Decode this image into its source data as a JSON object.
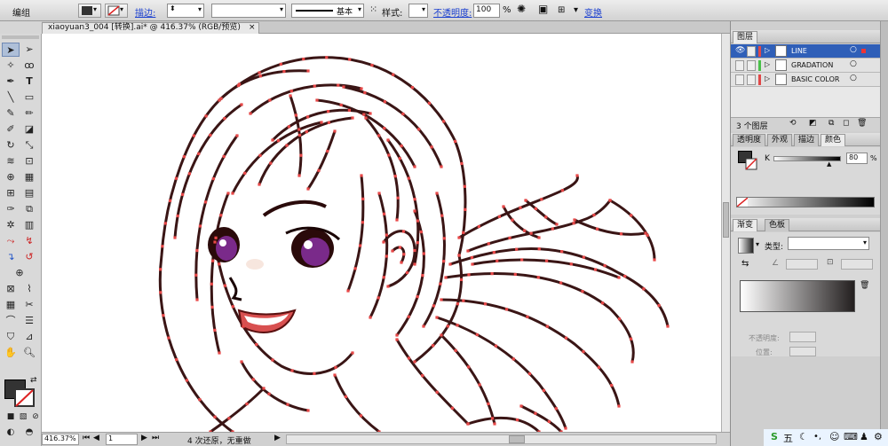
{
  "control_bar": {
    "object_type": "编组",
    "stroke_label": "描边:",
    "style_label": "样式:",
    "opacity_label": "不透明度:",
    "opacity_value": "100",
    "percent": "%",
    "brush_name": "基本",
    "transform_label": "变换"
  },
  "document_tab": {
    "title": "xiaoyuan3_004  [转换].ai* @ 416.37% (RGB/预览)",
    "close": "×"
  },
  "status_bar": {
    "zoom": "416.37%",
    "page": "1",
    "undo_info": "4 次还原，无重做"
  },
  "layers_panel": {
    "title": "图层",
    "layers": [
      {
        "name": "LINE",
        "color": "#e04848",
        "selected": true
      },
      {
        "name": "GRADATION",
        "color": "#48c048",
        "selected": false
      },
      {
        "name": "BASIC COLOR",
        "color": "#e04848",
        "selected": false
      }
    ],
    "count_label": "3 个图层"
  },
  "color_panel": {
    "tabs": [
      "透明度",
      "外观",
      "描边",
      "颜色"
    ],
    "active_tab": "颜色",
    "channel": "K",
    "value": "80",
    "percent": "%"
  },
  "gradient_panel": {
    "tabs": [
      "渐变",
      "色板"
    ],
    "active_tab": "渐变",
    "type_label": "类型:",
    "opacity_label": "不透明度:",
    "position_label": "位置:"
  },
  "taskbar": {
    "ime": "五"
  },
  "colors": {
    "accent": "#2f5fb8",
    "line_art": "#3a1515",
    "anchor": "#e84848"
  }
}
